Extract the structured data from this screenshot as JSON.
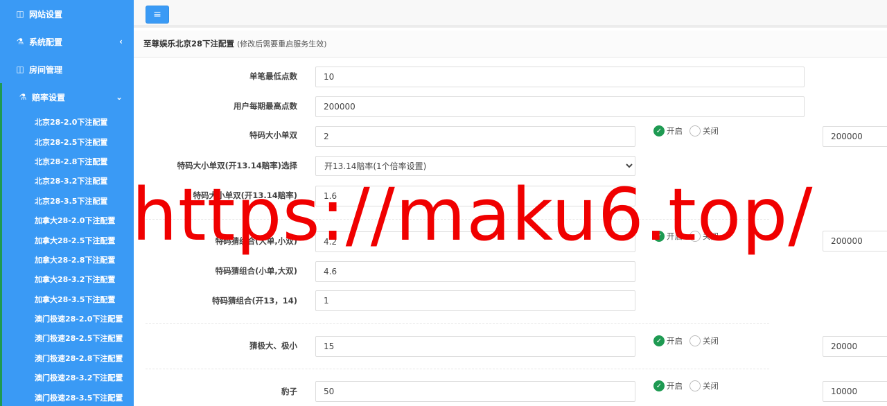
{
  "sidebar": {
    "items": [
      {
        "icon": "columns-icon",
        "glyph": "◫",
        "label": "网站设置"
      },
      {
        "icon": "flask-icon",
        "glyph": "⚗",
        "label": "系统配置",
        "chevron": "‹"
      },
      {
        "icon": "columns-icon",
        "glyph": "◫",
        "label": "房间管理"
      },
      {
        "icon": "flask-icon",
        "glyph": "⚗",
        "label": "赔率设置",
        "chevron": "⌄"
      }
    ],
    "sub_items": [
      "北京28-2.0下注配置",
      "北京28-2.5下注配置",
      "北京28-2.8下注配置",
      "北京28-3.2下注配置",
      "北京28-3.5下注配置",
      "加拿大28-2.0下注配置",
      "加拿大28-2.5下注配置",
      "加拿大28-2.8下注配置",
      "加拿大28-3.2下注配置",
      "加拿大28-3.5下注配置",
      "澳门极速28-2.0下注配置",
      "澳门极速28-2.5下注配置",
      "澳门极速28-2.8下注配置",
      "澳门极速28-3.2下注配置",
      "澳门极速28-3.5下注配置"
    ]
  },
  "topbar": {
    "menu_icon": "≡"
  },
  "panel": {
    "title": "至尊娱乐北京28下注配置",
    "subtitle": "(修改后需要重启服务生效)"
  },
  "form": {
    "min_bet": {
      "label": "单笔最低点数",
      "value": "10"
    },
    "max_bet": {
      "label": "用户每期最高点数",
      "value": "200000"
    },
    "special_dxds": {
      "label": "特码大小单双",
      "value": "2",
      "on_label": "开启",
      "off_label": "关闭",
      "limit": "200000"
    },
    "special_select": {
      "label": "特码大小单双(开13.14赔率)选择",
      "options": [
        "开13.14赔率(1个倍率设置)"
      ],
      "selected": "开13.14赔率(1个倍率设置)"
    },
    "special_1314": {
      "label": "特码大小单双(开13.14赔率)",
      "value": "1.6"
    },
    "combo_big_single": {
      "label": "特码猜组合(大单,小双)",
      "value": "4.2",
      "on_label": "开启",
      "off_label": "关闭",
      "limit": "200000"
    },
    "combo_small_single": {
      "label": "特码猜组合(小单,大双)",
      "value": "4.6"
    },
    "combo_1314": {
      "label": "特码猜组合(开13，14)",
      "value": "1"
    },
    "extreme": {
      "label": "猜极大、极小",
      "value": "15",
      "on_label": "开启",
      "off_label": "关闭",
      "limit": "20000"
    },
    "leopard": {
      "label": "豹子",
      "value": "50",
      "on_label": "开启",
      "off_label": "关闭",
      "limit": "10000"
    }
  },
  "watermark": "https://maku6.top/",
  "colors": {
    "sidebar": "#3a9af5",
    "accent_green": "#1e9a52",
    "watermark": "#f00000"
  }
}
